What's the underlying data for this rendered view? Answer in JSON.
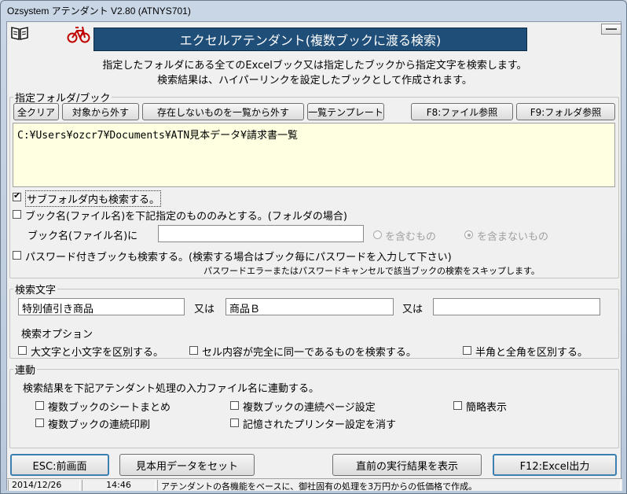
{
  "window": {
    "title": "Ozsystem アテンダント V2.80 (ATNYS701)"
  },
  "header": {
    "banner": "エクセルアテンダント(複数ブックに渡る検索)",
    "desc1": "指定したフォルダにある全てのExcelブック又は指定したブックから指定文字を検索します。",
    "desc2": "検索結果は、ハイパーリンクを設定したブックとして作成されます。"
  },
  "folder": {
    "legend": "指定フォルダ/ブック",
    "btn_clear": "全クリア",
    "btn_exclude": "対象から外す",
    "btn_remove_missing": "存在しないものを一覧から外す",
    "btn_template": "一覧テンプレート",
    "btn_f8": "F8:ファイル参照",
    "btn_f9": "F9:フォルダ参照",
    "path": "C:¥Users¥ozcr7¥Documents¥ATN見本データ¥請求書一覧",
    "subfolder_label": "サブフォルダ内も検索する。",
    "bookname_only_label": "ブック名(ファイル名)を下記指定のもののみとする。(フォルダの場合)",
    "bookname_field_label": "ブック名(ファイル名)に",
    "bookname_value": "",
    "radio_include": "を含むもの",
    "radio_exclude": "を含まないもの",
    "password_label": "パスワード付きブックも検索する。(検索する場合はブック毎にパスワードを入力して下さい)",
    "password_note": "パスワードエラーまたはパスワードキャンセルで該当ブックの検索をスキップします。"
  },
  "search": {
    "legend": "検索文字",
    "term1": "特別値引き商品",
    "or1": "又は",
    "term2": "商品Ｂ",
    "or2": "又は",
    "term3": "",
    "options_label": "検索オプション",
    "opt_case": "大文字と小文字を区別する。",
    "opt_exact": "セル内容が完全に同一であるものを検索する。",
    "opt_width": "半角と全角を区別する。"
  },
  "link": {
    "legend": "連動",
    "desc": "検索結果を下記アテンダント処理の入力ファイル名に連動する。",
    "opt_sheet_merge": "複数ブックのシートまとめ",
    "opt_page_setup": "複数ブックの連続ページ設定",
    "opt_simple": "簡略表示",
    "opt_print": "複数ブックの連続印刷",
    "opt_printer": "記憶されたプリンター設定を消す"
  },
  "footer": {
    "btn_esc": "ESC:前画面",
    "btn_sample": "見本用データをセット",
    "btn_last_result": "直前の実行結果を表示",
    "btn_f12": "F12:Excel出力"
  },
  "status": {
    "date": "2014/12/26",
    "time": "14:46",
    "message": "アテンダントの各機能をベースに、御社固有の処理を3万円からの低価格で作成。"
  }
}
